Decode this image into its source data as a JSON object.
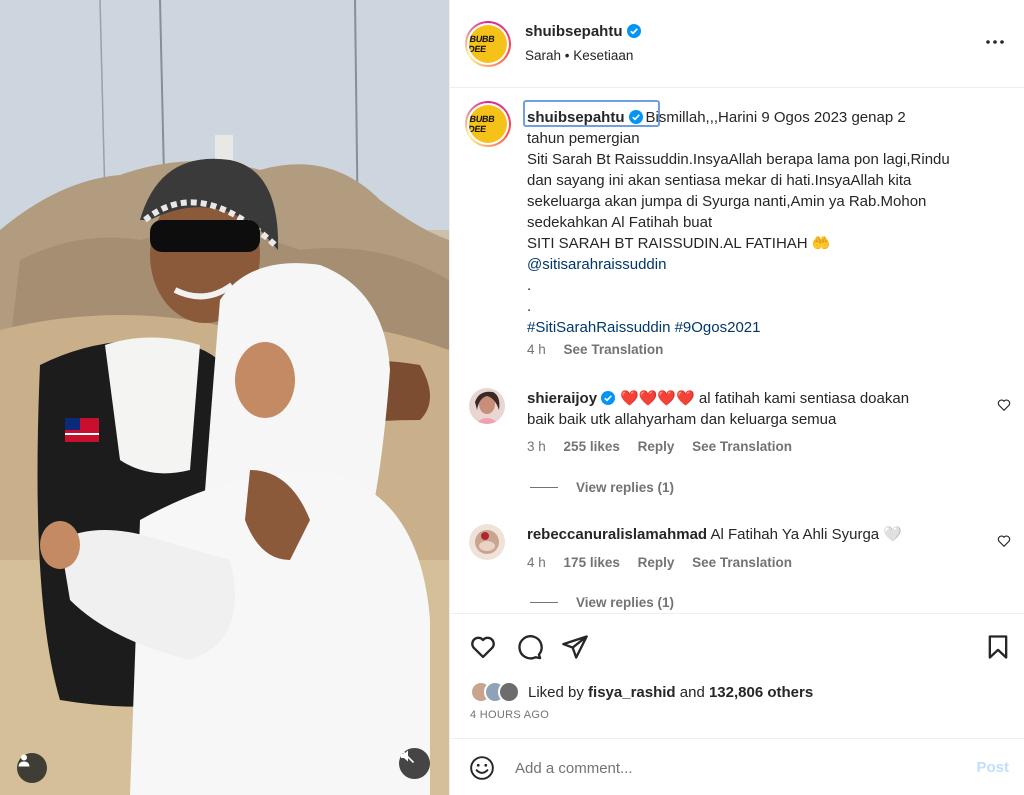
{
  "post": {
    "username": "shuibsepahtu",
    "audio_artist": "Sarah",
    "audio_title": "Kesetiaan",
    "audio_sep": "•",
    "logo_text": "BUBB DEE"
  },
  "caption": {
    "username": "shuibsepahtu",
    "text": "Bismillah,,,Harini 9 Ogos 2023 genap 2\ntahun pemergian\nSiti Sarah Bt Raissuddin.InsyaAllah berapa lama pon lagi,Rindu\ndan sayang ini akan sentiasa mekar di hati.InsyaAllah kita\nsekeluarga akan jumpa di Syurga nanti,Amin ya Rab.Mohon\nsedekahkan Al Fatihah buat\nSITI SARAH BT RAISSUDIN.AL FATIHAH 🤲",
    "mention": "@sitisarahraissuddin",
    "dots": ".\n.",
    "hashtags": "#SitiSarahRaissuddin #9Ogos2021",
    "time": "4 h",
    "see_translation": "See Translation"
  },
  "comments": [
    {
      "username": "shieraijoy",
      "text": "❤️❤️❤️❤️ al fatihah kami sentiasa doakan\nbaik baik utk allahyarham dan keluarga semua",
      "time": "3 h",
      "likes": "255 likes",
      "reply": "Reply",
      "see_translation": "See Translation",
      "view_replies": "View replies (1)"
    },
    {
      "username": "rebeccanuralislamahmad",
      "text": "Al Fatihah Ya Ahli Syurga 🤍",
      "time": "4 h",
      "likes": "175 likes",
      "reply": "Reply",
      "see_translation": "See Translation",
      "view_replies": "View replies (1)"
    }
  ],
  "likes": {
    "prefix": "Liked by",
    "user": "fisya_rashid",
    "and": "and",
    "others": "132,806 others"
  },
  "timestamp": "4 HOURS AGO",
  "comment_box": {
    "placeholder": "Add a comment...",
    "post_label": "Post"
  },
  "colors": {
    "verified": "#0095f6",
    "link": "#00376b",
    "heart_red": "#e0245e",
    "post_disabled": "#c0dffd",
    "logo_yellow": "#f5c21a"
  },
  "icons": [
    "more-icon",
    "heart-icon",
    "comment-icon",
    "share-icon",
    "bookmark-icon",
    "emoji-icon",
    "user-tag-icon",
    "muted-icon",
    "verified-icon"
  ]
}
